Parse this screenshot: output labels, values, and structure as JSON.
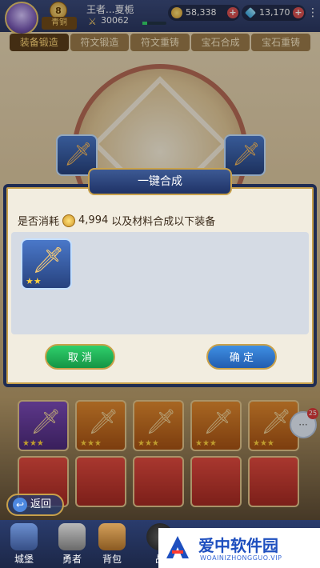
{
  "header": {
    "level": "8",
    "title_tag": "青铜",
    "player_name": "王者...夏栀",
    "power": "30062",
    "gold": "58,338",
    "gems": "13,170"
  },
  "tabs": [
    {
      "label": "装备锻造"
    },
    {
      "label": "符文锻造"
    },
    {
      "label": "符文重铸"
    },
    {
      "label": "宝石合成"
    },
    {
      "label": "宝石重铸"
    }
  ],
  "modal": {
    "title": "一键合成",
    "message_prefix": "是否消耗",
    "cost": "4,994",
    "message_suffix": "以及材料合成以下装备",
    "item_stars": "★★",
    "cancel_label": "取 消",
    "confirm_label": "确 定"
  },
  "inventory": {
    "stars3": "★★★"
  },
  "chat": {
    "badge": "25"
  },
  "nav": {
    "back_label": "返回",
    "castle": "城堡",
    "hero": "勇者",
    "bag": "背包",
    "battle": "战"
  },
  "watermark": {
    "title": "爱中软件园",
    "subtitle": "WOAINIZHONGGUO.VIP"
  },
  "colors": {
    "accent_blue": "#1f2c52",
    "gold_border": "#c9a14a",
    "confirm_blue": "#3f8fe3",
    "cancel_green": "#2fcf6c"
  }
}
